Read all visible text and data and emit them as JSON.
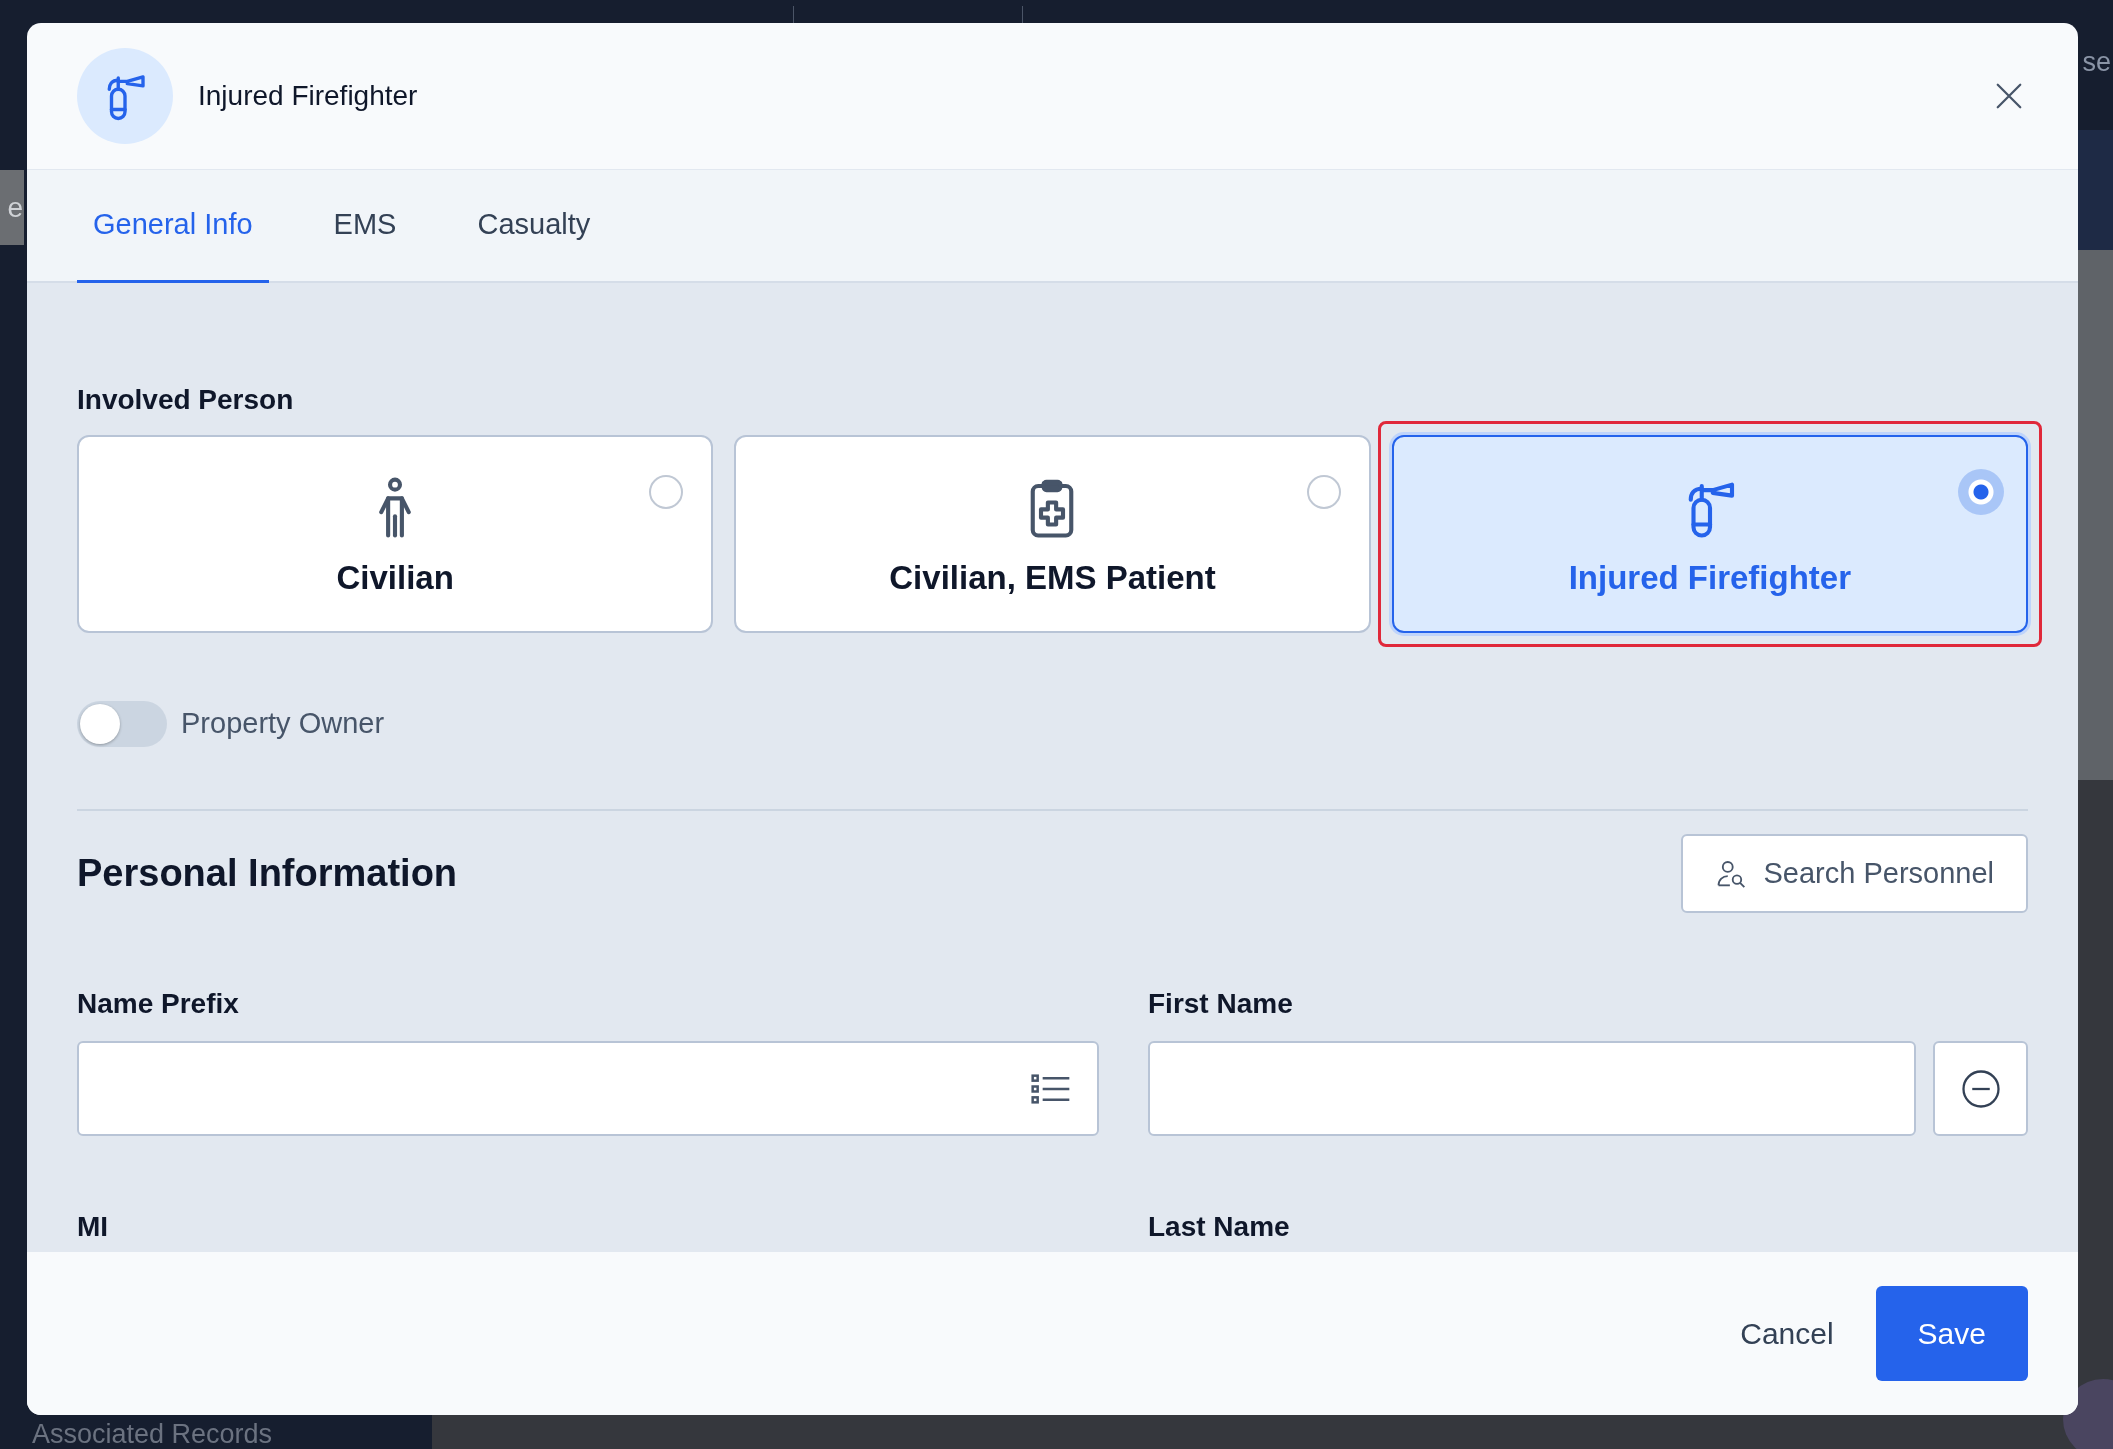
{
  "background": {
    "right_text": "se",
    "side_button": "e",
    "sidebar_footer": "Associated Records"
  },
  "modal": {
    "title": "Injured Firefighter",
    "tabs": [
      {
        "label": "General Info",
        "selected": true
      },
      {
        "label": "EMS",
        "selected": false
      },
      {
        "label": "Casualty",
        "selected": false
      }
    ],
    "involved_person": {
      "label": "Involved Person",
      "options": [
        {
          "label": "Civilian",
          "kind": "person",
          "selected": false,
          "highlighted": false
        },
        {
          "label": "Civilian, EMS Patient",
          "kind": "clipboard",
          "selected": false,
          "highlighted": false
        },
        {
          "label": "Injured Firefighter",
          "kind": "extinguisher",
          "selected": true,
          "highlighted": true
        }
      ]
    },
    "property_owner": {
      "label": "Property Owner",
      "on": false
    },
    "personal_information": {
      "title": "Personal Information",
      "search_button": "Search Personnel",
      "fields": [
        {
          "label": "Name Prefix",
          "kind": "select"
        },
        {
          "label": "First Name",
          "kind": "clearable"
        },
        {
          "label": "MI",
          "kind": "label_only"
        },
        {
          "label": "Last Name",
          "kind": "label_only"
        }
      ]
    },
    "buttons": [
      {
        "label": "Cancel",
        "kind": "secondary"
      },
      {
        "label": "Save",
        "kind": "primary"
      }
    ]
  }
}
